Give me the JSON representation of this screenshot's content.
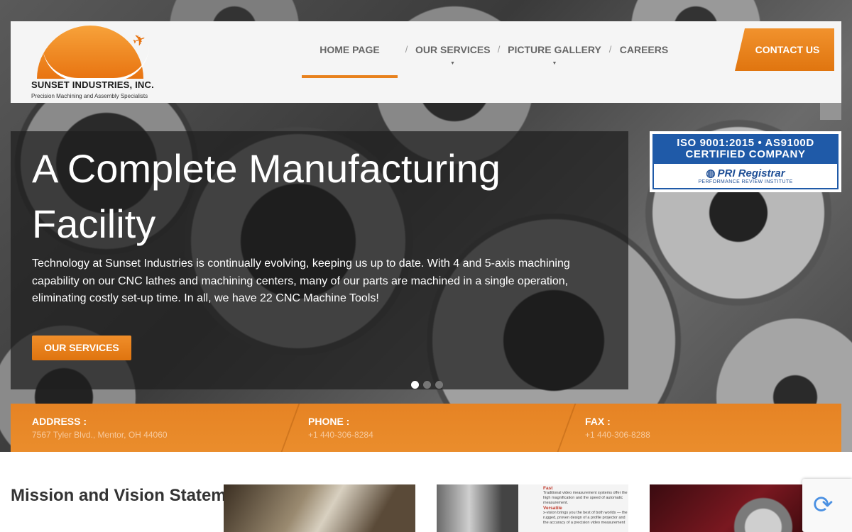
{
  "header": {
    "logo": {
      "name": "SUNSET INDUSTRIES, INC.",
      "tagline": "Precision Machining and Assembly Specialists"
    },
    "nav": {
      "items": [
        {
          "label": "HOME PAGE",
          "active": true
        },
        {
          "label": "OUR SERVICES",
          "has_dropdown": true
        },
        {
          "label": "PICTURE GALLERY",
          "has_dropdown": true
        },
        {
          "label": "CAREERS"
        }
      ],
      "separator": "/"
    },
    "contact_button": "CONTACT US"
  },
  "slider": {
    "title": "A Complete Manufacturing Facility",
    "text": "Technology at Sunset Industries is continually evolving, keeping us up to date. With 4 and 5-axis machining capability on our CNC lathes and machining centers, many of our parts are machined in a single operation, eliminating costly set-up time. In all, we have 22 CNC Machine Tools!",
    "button": "OUR SERVICES",
    "active_slide": 1,
    "slide_count": 3
  },
  "badge": {
    "line1": "ISO 9001:2015 • AS9100D",
    "line2": "CERTIFIED COMPANY",
    "registrar": "PRI Registrar",
    "registrar_sub": "PERFORMANCE REVIEW INSTITUTE"
  },
  "info": {
    "address": {
      "label": "ADDRESS :",
      "value": "7567 Tyler Blvd., Mentor, OH 44060"
    },
    "phone": {
      "label": "PHONE :",
      "value": "+1 440-306-8284"
    },
    "fax": {
      "label": "FAX :",
      "value": "+1 440-306-8288"
    }
  },
  "mission": {
    "light": "Mission",
    "bold": "and Vision Statement"
  },
  "thumbnails": {
    "doc_heading1": "Fast",
    "doc_text1": "Traditional video measurement systems offer the high magnification and the speed of automatic measurement.",
    "doc_heading2": "Versatile",
    "doc_text2": "x-vision brings you the best of both worlds — the rugged, proven design of a profile projector and the accuracy of a precision video measurement"
  },
  "colors": {
    "accent": "#e8821e",
    "header_bg": "#f5f5f5",
    "badge_blue": "#1f5aa8"
  }
}
